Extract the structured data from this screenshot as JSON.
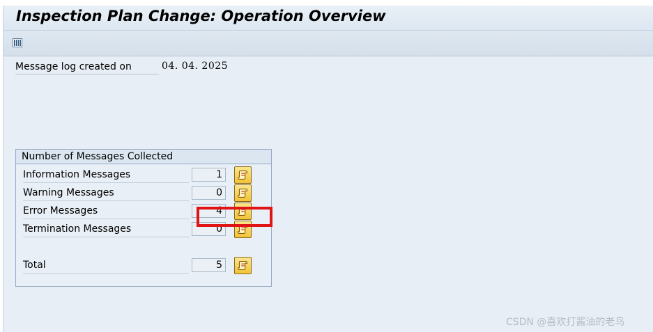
{
  "window": {
    "title": "Inspection Plan Change: Operation Overview"
  },
  "toolbar": {
    "buttons": [
      {
        "icon": "columns-icon"
      }
    ]
  },
  "log": {
    "label": "Message log created on",
    "date": "04. 04. 2025"
  },
  "messages_group": {
    "title": "Number of Messages Collected",
    "rows": [
      {
        "label": "Information Messages",
        "count": "1"
      },
      {
        "label": "Warning Messages",
        "count": "0"
      },
      {
        "label": "Error Messages",
        "count": "4"
      },
      {
        "label": "Termination Messages",
        "count": "0"
      }
    ],
    "total": {
      "label": "Total",
      "count": "5"
    }
  },
  "annotation": {
    "highlight_color": "#e01414"
  },
  "watermark": "CSDN @喜欢打酱油的老鸟"
}
